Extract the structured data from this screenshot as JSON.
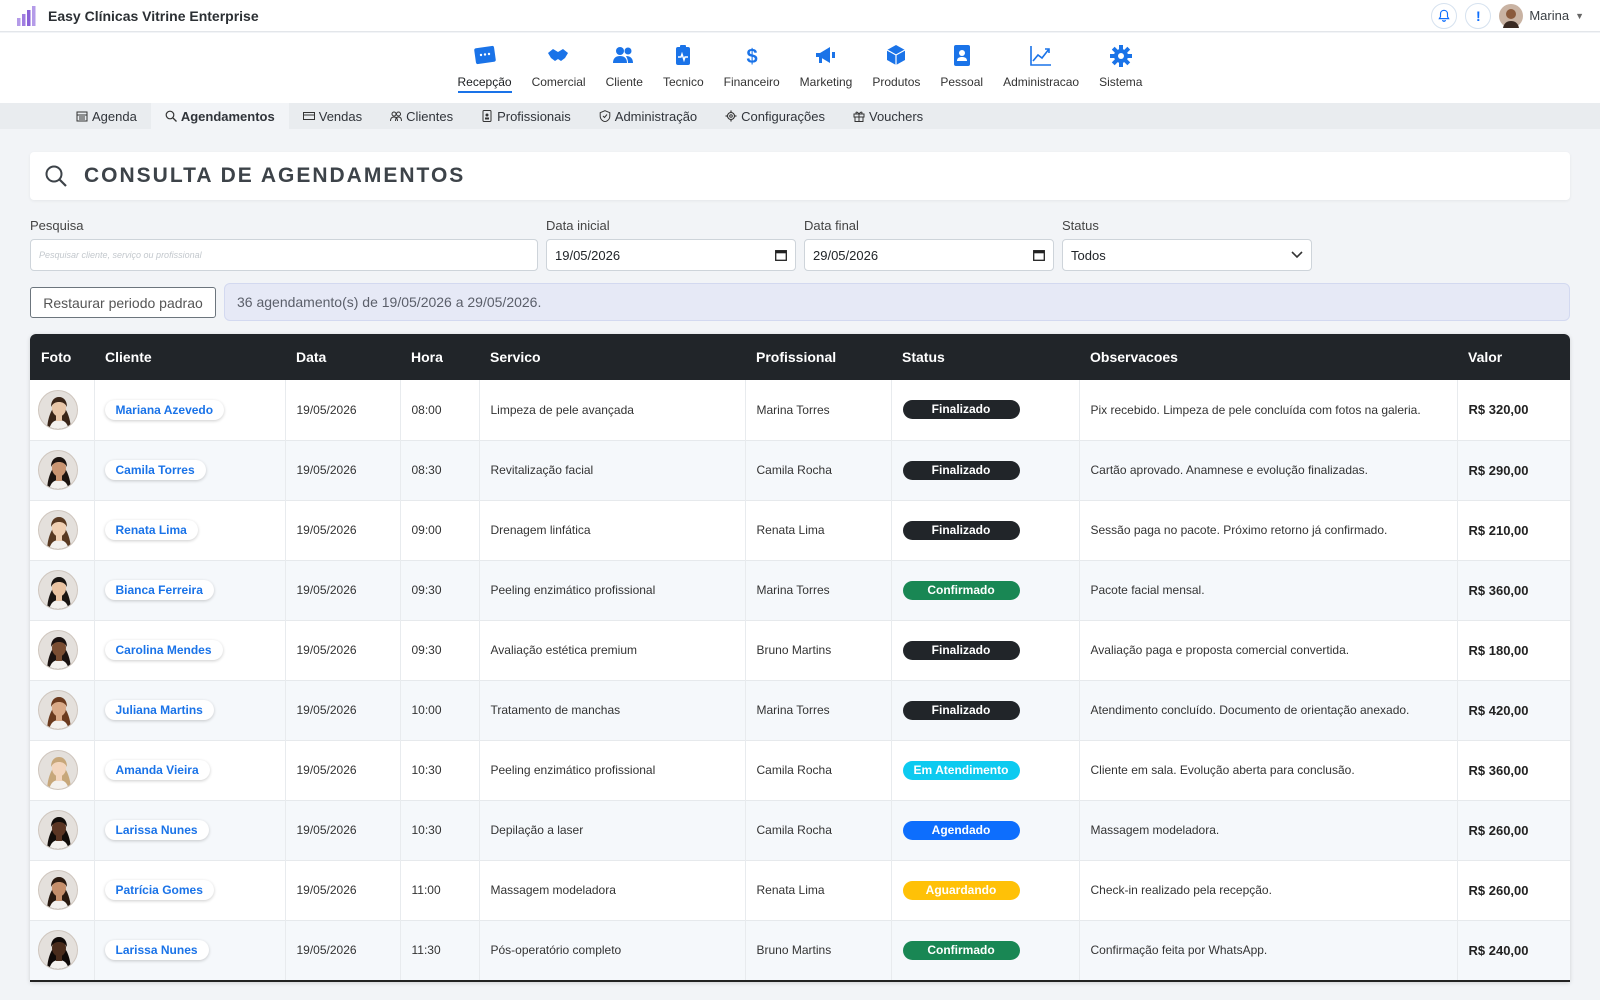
{
  "app": {
    "title": "Easy Clínicas Vitrine Enterprise",
    "user_name": "Marina",
    "info_label": "!"
  },
  "modules": [
    {
      "label": "Recepção",
      "icon": "reception-icon",
      "active": true
    },
    {
      "label": "Comercial",
      "icon": "handshake-icon",
      "active": false
    },
    {
      "label": "Cliente",
      "icon": "users-icon",
      "active": false
    },
    {
      "label": "Tecnico",
      "icon": "clipboard-pulse-icon",
      "active": false
    },
    {
      "label": "Financeiro",
      "icon": "dollar-icon",
      "active": false
    },
    {
      "label": "Marketing",
      "icon": "megaphone-icon",
      "active": false
    },
    {
      "label": "Produtos",
      "icon": "box-icon",
      "active": false
    },
    {
      "label": "Pessoal",
      "icon": "badge-icon",
      "active": false
    },
    {
      "label": "Administracao",
      "icon": "chart-line-icon",
      "active": false
    },
    {
      "label": "Sistema",
      "icon": "gear-icon",
      "active": false
    }
  ],
  "subnav": [
    {
      "label": "Agenda",
      "icon": "calendar-icon",
      "active": false
    },
    {
      "label": "Agendamentos",
      "icon": "search-icon",
      "active": true
    },
    {
      "label": "Vendas",
      "icon": "card-icon",
      "active": false
    },
    {
      "label": "Clientes",
      "icon": "people-icon",
      "active": false
    },
    {
      "label": "Profissionais",
      "icon": "id-badge-icon",
      "active": false
    },
    {
      "label": "Administração",
      "icon": "shield-icon",
      "active": false
    },
    {
      "label": "Configurações",
      "icon": "gear-icon",
      "active": false
    },
    {
      "label": "Vouchers",
      "icon": "gift-icon",
      "active": false
    }
  ],
  "page": {
    "title": "CONSULTA DE AGENDAMENTOS"
  },
  "filters": {
    "search_label": "Pesquisa",
    "search_placeholder": "Pesquisar cliente, serviço ou profissional",
    "start_label": "Data inicial",
    "start_value": "19/05/2026",
    "end_label": "Data final",
    "end_value": "29/05/2026",
    "status_label": "Status",
    "status_value": "Todos",
    "reset_button": "Restaurar periodo padrao",
    "summary": "36 agendamento(s) de 19/05/2026 a 29/05/2026."
  },
  "table": {
    "headers": [
      "Foto",
      "Cliente",
      "Data",
      "Hora",
      "Servico",
      "Profissional",
      "Status",
      "Observacoes",
      "Valor"
    ],
    "rows": [
      {
        "cliente": "Mariana Azevedo",
        "data": "19/05/2026",
        "hora": "08:00",
        "servico": "Limpeza de pele avançada",
        "profissional": "Marina Torres",
        "status": "Finalizado",
        "obs": "Pix recebido. Limpeza de pele concluída com fotos na galeria.",
        "valor": "R$ 320,00"
      },
      {
        "cliente": "Camila Torres",
        "data": "19/05/2026",
        "hora": "08:30",
        "servico": "Revitalização facial",
        "profissional": "Camila Rocha",
        "status": "Finalizado",
        "obs": "Cartão aprovado. Anamnese e evolução finalizadas.",
        "valor": "R$ 290,00"
      },
      {
        "cliente": "Renata Lima",
        "data": "19/05/2026",
        "hora": "09:00",
        "servico": "Drenagem linfática",
        "profissional": "Renata Lima",
        "status": "Finalizado",
        "obs": "Sessão paga no pacote. Próximo retorno já confirmado.",
        "valor": "R$ 210,00"
      },
      {
        "cliente": "Bianca Ferreira",
        "data": "19/05/2026",
        "hora": "09:30",
        "servico": "Peeling enzimático profissional",
        "profissional": "Marina Torres",
        "status": "Confirmado",
        "obs": "Pacote facial mensal.",
        "valor": "R$ 360,00"
      },
      {
        "cliente": "Carolina Mendes",
        "data": "19/05/2026",
        "hora": "09:30",
        "servico": "Avaliação estética premium",
        "profissional": "Bruno Martins",
        "status": "Finalizado",
        "obs": "Avaliação paga e proposta comercial convertida.",
        "valor": "R$ 180,00"
      },
      {
        "cliente": "Juliana Martins",
        "data": "19/05/2026",
        "hora": "10:00",
        "servico": "Tratamento de manchas",
        "profissional": "Marina Torres",
        "status": "Finalizado",
        "obs": "Atendimento concluído. Documento de orientação anexado.",
        "valor": "R$ 420,00"
      },
      {
        "cliente": "Amanda Vieira",
        "data": "19/05/2026",
        "hora": "10:30",
        "servico": "Peeling enzimático profissional",
        "profissional": "Camila Rocha",
        "status": "Em Atendimento",
        "obs": "Cliente em sala. Evolução aberta para conclusão.",
        "valor": "R$ 360,00"
      },
      {
        "cliente": "Larissa Nunes",
        "data": "19/05/2026",
        "hora": "10:30",
        "servico": "Depilação a laser",
        "profissional": "Camila Rocha",
        "status": "Agendado",
        "obs": "Massagem modeladora.",
        "valor": "R$ 260,00"
      },
      {
        "cliente": "Patrícia Gomes",
        "data": "19/05/2026",
        "hora": "11:00",
        "servico": "Massagem modeladora",
        "profissional": "Renata Lima",
        "status": "Aguardando",
        "obs": "Check-in realizado pela recepção.",
        "valor": "R$ 260,00"
      },
      {
        "cliente": "Larissa Nunes",
        "data": "19/05/2026",
        "hora": "11:30",
        "servico": "Pós-operatório completo",
        "profissional": "Bruno Martins",
        "status": "Confirmado",
        "obs": "Confirmação feita por WhatsApp.",
        "valor": "R$ 240,00"
      }
    ]
  },
  "status_colors": {
    "Finalizado": "#212529",
    "Confirmado": "#198754",
    "Em Atendimento": "#0dcaf0",
    "Agendado": "#0d6efd",
    "Aguardando": "#ffc107"
  },
  "colors": {
    "accent": "#1a73e8",
    "header_dark": "#212529"
  }
}
